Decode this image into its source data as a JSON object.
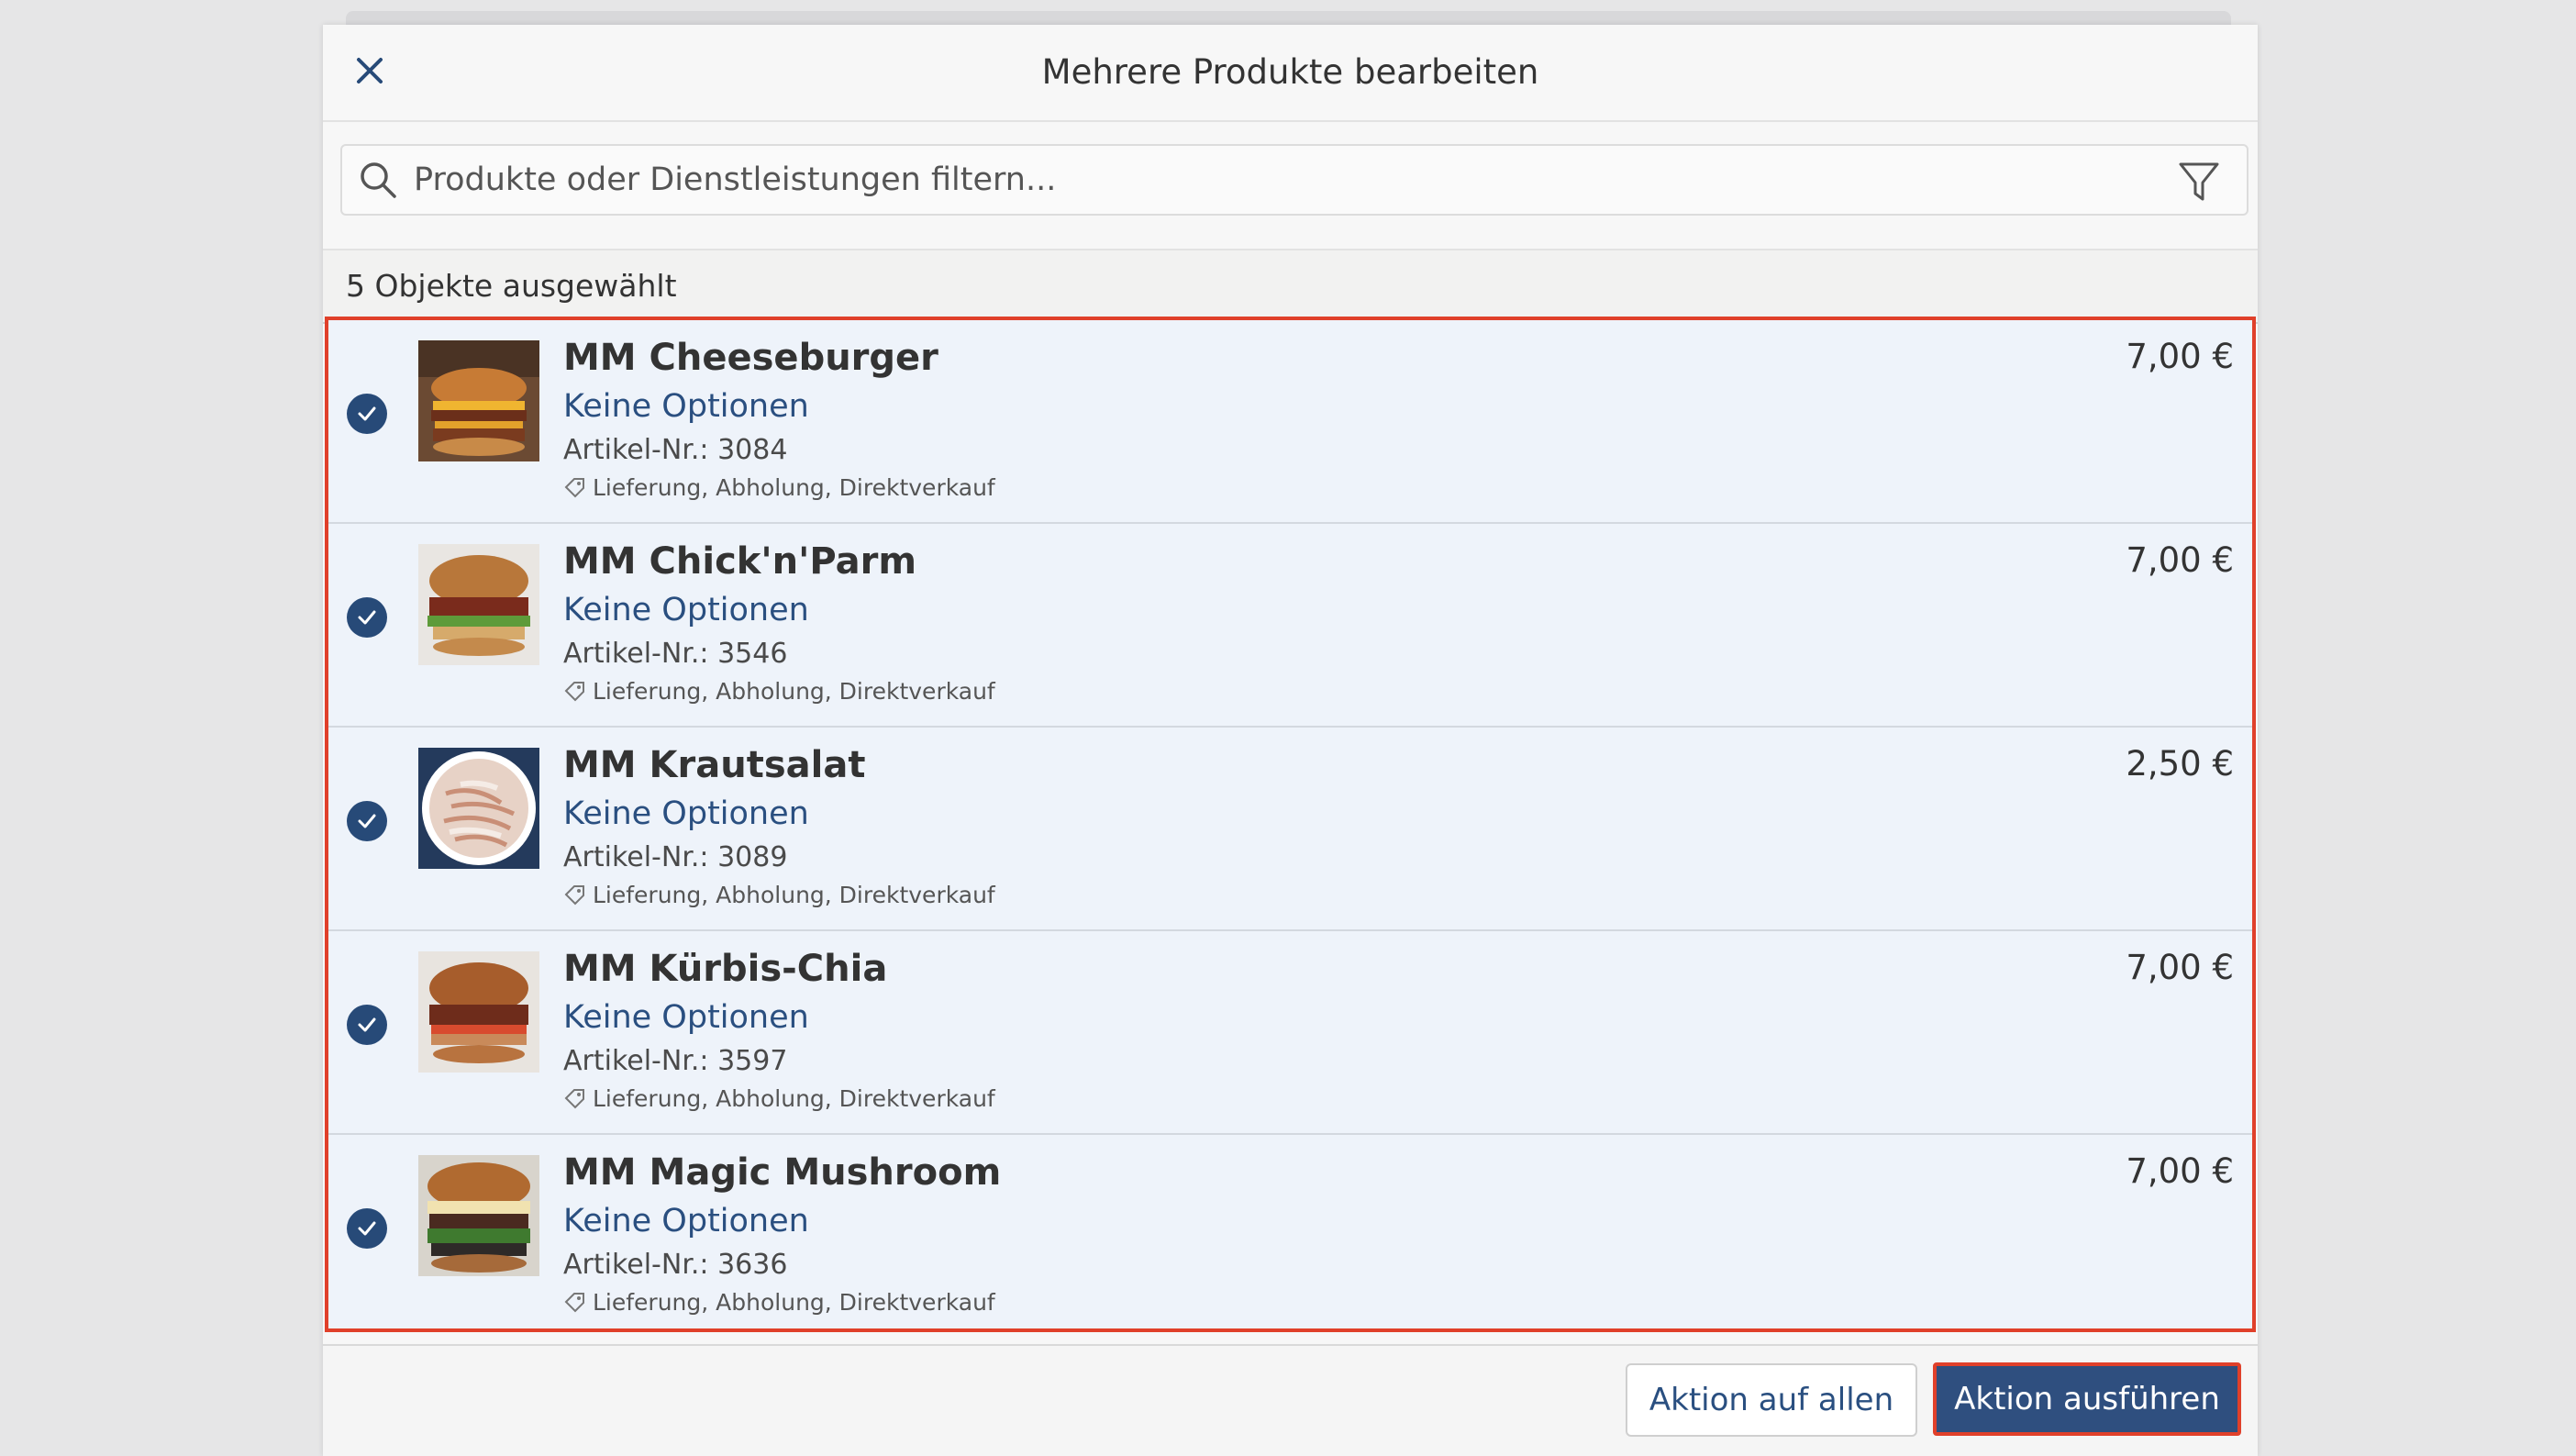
{
  "dialog": {
    "title": "Mehrere Produkte bearbeiten"
  },
  "search": {
    "placeholder": "Produkte oder Dienstleistungen filtern..."
  },
  "selection": {
    "count_label": "5 Objekte ausgewählt"
  },
  "colors": {
    "accent": "#2f4f7f",
    "highlight_border": "#e0402a",
    "selected_row_bg": "#eef3fa",
    "option_text": "#2a4f80"
  },
  "products": [
    {
      "name": "MM Cheeseburger",
      "options": "Keine Optionen",
      "article": "Artikel-Nr.: 3084",
      "channels": "Lieferung, Abholung, Direktverkauf",
      "price": "7,00 €",
      "image": "cheeseburger-photo"
    },
    {
      "name": "MM Chick'n'Parm",
      "options": "Keine Optionen",
      "article": "Artikel-Nr.: 3546",
      "channels": "Lieferung, Abholung, Direktverkauf",
      "price": "7,00 €",
      "image": "chicken-burger-photo"
    },
    {
      "name": "MM Krautsalat",
      "options": "Keine Optionen",
      "article": "Artikel-Nr.: 3089",
      "channels": "Lieferung, Abholung, Direktverkauf",
      "price": "2,50 €",
      "image": "coleslaw-photo"
    },
    {
      "name": "MM Kürbis-Chia",
      "options": "Keine Optionen",
      "article": "Artikel-Nr.: 3597",
      "channels": "Lieferung, Abholung, Direktverkauf",
      "price": "7,00 €",
      "image": "pumpkin-burger-photo"
    },
    {
      "name": "MM Magic Mushroom",
      "options": "Keine Optionen",
      "article": "Artikel-Nr.: 3636",
      "channels": "Lieferung, Abholung, Direktverkauf",
      "price": "7,00 €",
      "image": "mushroom-burger-photo"
    }
  ],
  "footer": {
    "secondary_label": "Aktion auf allen",
    "primary_label": "Aktion ausführen"
  },
  "icons": {
    "close": "close-icon",
    "search": "search-icon",
    "filter": "filter-icon",
    "check": "check-circle-icon",
    "tag": "tag-icon"
  }
}
